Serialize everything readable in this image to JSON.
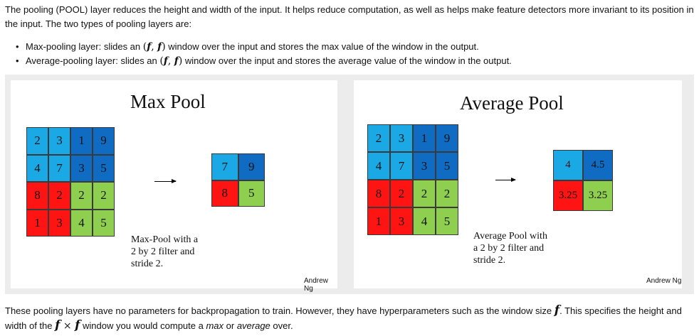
{
  "intro": "The pooling (POOL) layer reduces the height and width of the input. It helps reduce computation, as well as helps make feature detectors more invariant to its position in the input. The two types of pooling layers are:",
  "bullets": [
    {
      "before": "Max-pooling layer: slides an ",
      "after": " window over the input and stores the max value of the window in the output."
    },
    {
      "before": "Average-pooling layer: slides an ",
      "after": " window over the input and stores the average value of the window in the output."
    }
  ],
  "window_math": {
    "open": "(",
    "f1": "f",
    "comma": ", ",
    "f2": "f",
    "close": ")"
  },
  "figure": {
    "left": {
      "title": "Max Pool",
      "input": [
        [
          "2",
          "3",
          "1",
          "9"
        ],
        [
          "4",
          "7",
          "3",
          "5"
        ],
        [
          "8",
          "2",
          "2",
          "2"
        ],
        [
          "1",
          "3",
          "4",
          "5"
        ]
      ],
      "output": [
        [
          "7",
          "9"
        ],
        [
          "8",
          "5"
        ]
      ],
      "caption": [
        "Max-Pool with a",
        "2 by 2 filter and",
        "stride 2."
      ],
      "credit": "Andrew Ng"
    },
    "right": {
      "title": "Average Pool",
      "input": [
        [
          "2",
          "3",
          "1",
          "9"
        ],
        [
          "4",
          "7",
          "3",
          "5"
        ],
        [
          "8",
          "2",
          "2",
          "2"
        ],
        [
          "1",
          "3",
          "4",
          "5"
        ]
      ],
      "output": [
        [
          "4",
          "4.5"
        ],
        [
          "3.25",
          "3.25"
        ]
      ],
      "caption": [
        "Average Pool with",
        "a 2 by 2 filter and",
        "stride 2."
      ],
      "credit": "Andrew Ng"
    },
    "quadrant_colors": {
      "top_left": "#1ba9e6",
      "top_right": "#0f6cc2",
      "bottom_left": "#ff1414",
      "bottom_right": "#8fcf4f"
    }
  },
  "outro": {
    "part1": "These pooling layers have no parameters for backpropagation to train. However, they have hyperparameters such as the window size ",
    "f": "f",
    "part2": ". This specifies the height and width of the ",
    "fxf_a": "f",
    "times": " × ",
    "fxf_b": "f",
    "part3": " window you would compute a ",
    "max": "max",
    "or": " or ",
    "average": "average",
    "part4": " over."
  }
}
